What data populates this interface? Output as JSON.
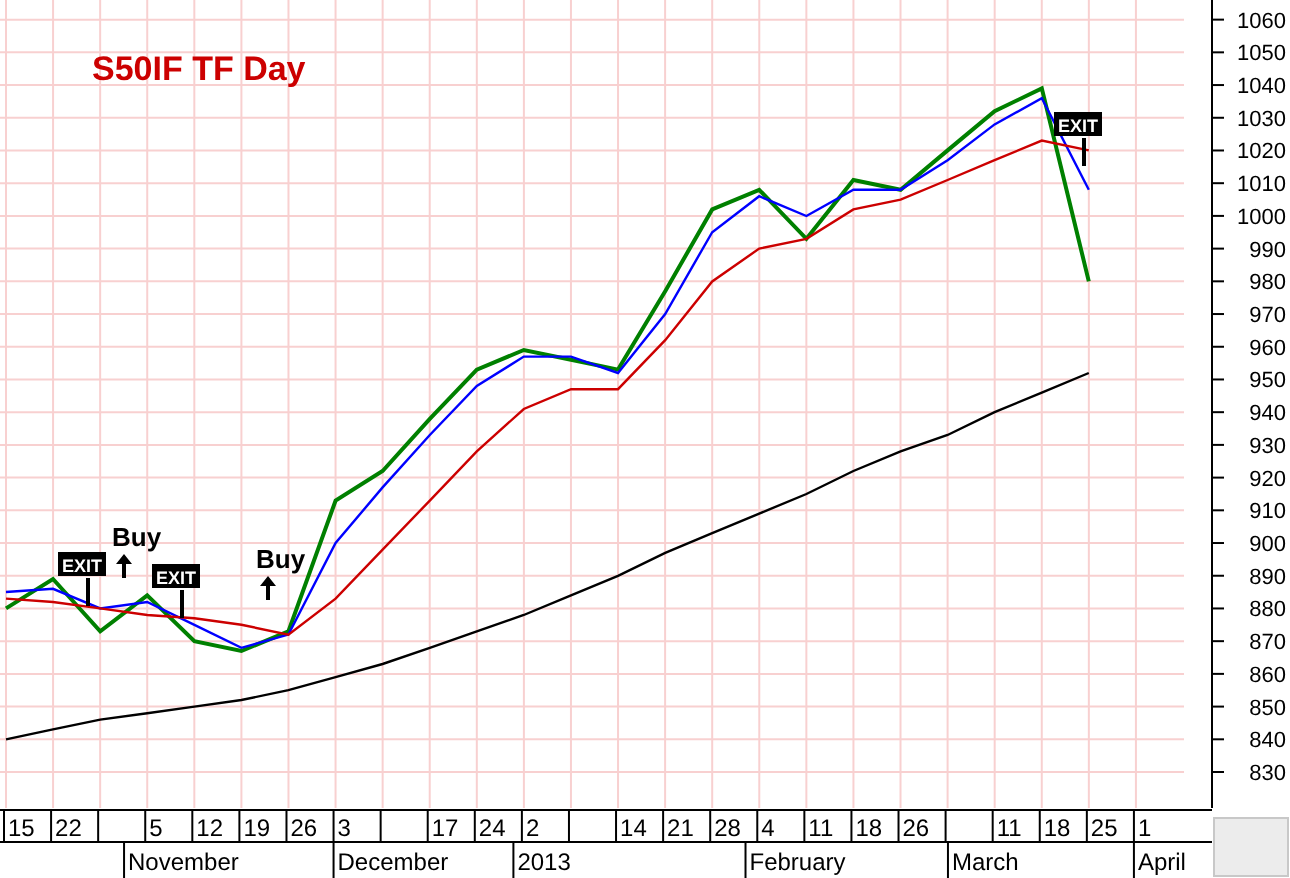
{
  "chart": {
    "chart_data": {
      "type": "line",
      "title": "S50IF TF Day",
      "categories": [
        "15",
        "22",
        null,
        "5",
        "12",
        "19",
        "26",
        "3",
        null,
        "17",
        "24",
        "2",
        null,
        "14",
        "21",
        "28",
        "4",
        "11",
        "18",
        "26",
        null,
        "11",
        "18",
        "25",
        "1"
      ],
      "series": [
        {
          "color": "#008000",
          "values": [
            880,
            889,
            873,
            884,
            870,
            867,
            873,
            913,
            922,
            938,
            953,
            959,
            956,
            953,
            977,
            1002,
            1008,
            993,
            1011,
            1008,
            1020,
            1032,
            1039,
            980,
            null
          ]
        },
        {
          "color": "#0000ff",
          "values": [
            885,
            886,
            880,
            882,
            875,
            868,
            872,
            900,
            917,
            933,
            948,
            957,
            957,
            952,
            970,
            995,
            1006,
            1000,
            1008,
            1008,
            1017,
            1028,
            1036,
            1008,
            null
          ]
        },
        {
          "color": "#cc0000",
          "values": [
            883,
            882,
            880,
            878,
            877,
            875,
            872,
            883,
            898,
            913,
            928,
            941,
            947,
            947,
            962,
            980,
            990,
            993,
            1002,
            1005,
            1011,
            1017,
            1023,
            1020,
            null
          ]
        },
        {
          "color": "#000000",
          "values": [
            840,
            843,
            846,
            848,
            850,
            852,
            855,
            859,
            863,
            868,
            873,
            878,
            884,
            890,
            897,
            903,
            909,
            915,
            922,
            928,
            933,
            940,
            946,
            952,
            null
          ]
        }
      ],
      "ylim": [
        819,
        1066
      ],
      "grid": true,
      "yticks": [
        830,
        840,
        850,
        860,
        870,
        880,
        890,
        900,
        910,
        920,
        930,
        940,
        950,
        960,
        970,
        980,
        990,
        1000,
        1010,
        1020,
        1030,
        1040,
        1050,
        1060
      ],
      "annotations": [
        "EXIT",
        "Buy",
        "EXIT",
        "Buy",
        "EXIT"
      ]
    },
    "month_labels": [
      "November",
      "December",
      "2013",
      "February",
      "March",
      "April"
    ]
  }
}
